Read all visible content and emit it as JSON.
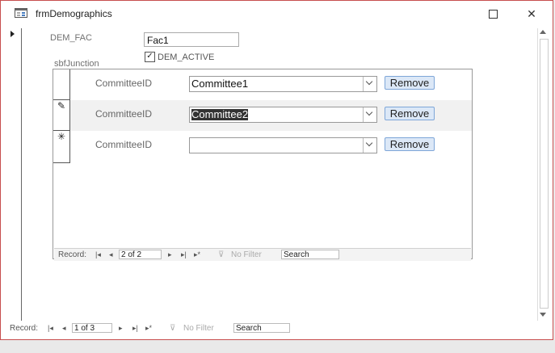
{
  "window": {
    "title": "frmDemographics",
    "icon": "form-icon"
  },
  "form": {
    "dem_fac_label": "DEM_FAC",
    "dem_fac_value": "Fac1",
    "dem_active_label": "DEM_ACTIVE",
    "dem_active_checked": true,
    "subform_label": "sbfJunction"
  },
  "subform": {
    "rows": [
      {
        "field_label": "CommitteeID",
        "value": "Committee1",
        "button": "Remove",
        "selector": ""
      },
      {
        "field_label": "CommitteeID",
        "value": "Committee2",
        "button": "Remove",
        "selector": "✎"
      },
      {
        "field_label": "CommitteeID",
        "value": "",
        "button": "Remove",
        "selector": "✳"
      }
    ],
    "nav": {
      "record_label": "Record:",
      "position": "2 of 2",
      "no_filter": "No Filter",
      "search": "Search"
    }
  },
  "main_nav": {
    "record_label": "Record:",
    "position": "1 of 3",
    "no_filter": "No Filter",
    "search": "Search"
  }
}
